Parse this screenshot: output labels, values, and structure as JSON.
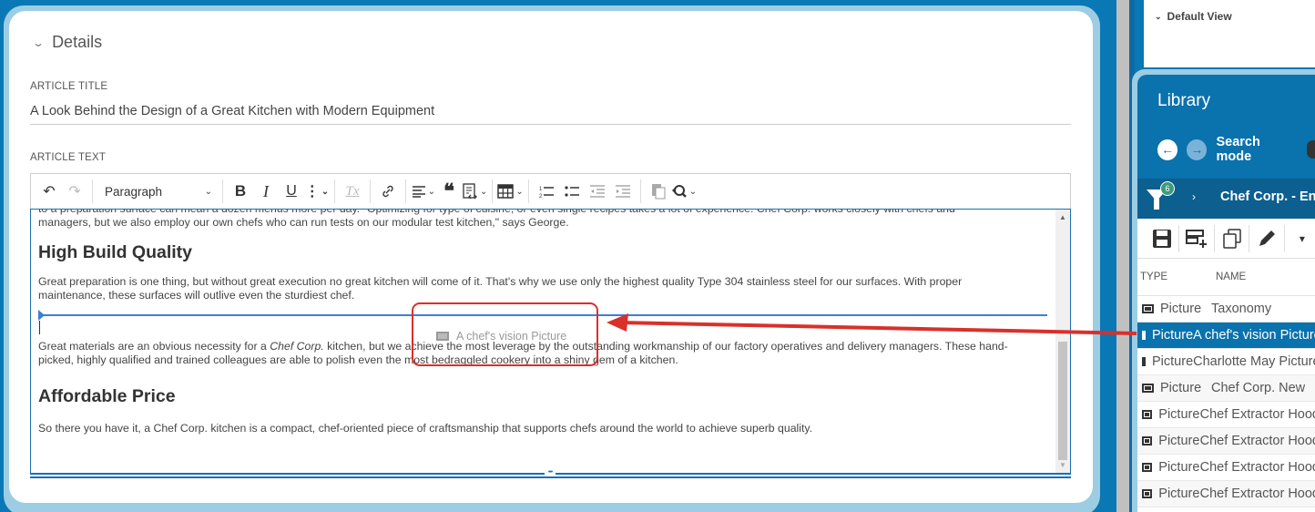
{
  "details": {
    "section_title": "Details",
    "article_title_label": "ARTICLE TITLE",
    "article_title_value": "A Look Behind the Design of a Great Kitchen with Modern Equipment",
    "article_text_label": "ARTICLE TEXT"
  },
  "toolbar": {
    "undo": "undo-icon",
    "redo": "redo-icon",
    "paragraph_format": "Paragraph",
    "bold": "B",
    "italic": "I",
    "underline": "U",
    "more": "⋮",
    "remove_format": "Tx",
    "link": "link-icon",
    "align": "align-left-icon",
    "blockquote": "❝",
    "source": "source-icon",
    "table": "table-icon",
    "numbered_list": "numbered-list-icon",
    "bulleted_list": "bulleted-list-icon",
    "outdent": "outdent-icon",
    "indent": "indent-icon",
    "paste": "paste-icon",
    "find_replace": "find-replace-icon"
  },
  "editor": {
    "para_top_line1": "to a preparation surface can mean a dozen menus more per day. \"Optimizing for type of cuisine, or even single recipes takes a lot of experience. Chef Corp. works closely with chefs and",
    "para_top_line2": "managers, but we also employ our own chefs who can run tests on our modular test kitchen,\" says George.",
    "heading_1": "High Build Quality",
    "para_1": "Great preparation is one thing, but without great execution no great kitchen will come of it. That's why we use only the highest quality Type 304 stainless steel for our surfaces. With proper maintenance, these surfaces will outlive even the sturdiest chef.",
    "drag_ghost_label": "A chef's vision Picture",
    "para_2_before": "Great materials are an obvious necessity for a ",
    "para_2_italic": "Chef Corp.",
    "para_2_after": " kitchen, but we achieve the most leverage by the outstanding workmanship of our factory operatives and delivery managers. These hand-picked, highly qualified and trained colleagues are able to polish even the most bedraggled cookery into a shiny gem of a kitchen.",
    "heading_2": "Affordable Price",
    "para_3": "So there you have it, a Chef Corp. kitchen is a compact, chef-oriented piece of craftsmanship that supports chefs around the world to achieve superb quality."
  },
  "right_panel": {
    "default_view": "Default View"
  },
  "library": {
    "title": "Library",
    "mode": "Search mode",
    "filter_count": "6",
    "path": "Chef Corp. - English",
    "columns": {
      "type": "TYPE",
      "name": "NAME"
    },
    "rows": [
      {
        "type": "Picture",
        "name": "Taxonomy",
        "selected": false
      },
      {
        "type": "Picture",
        "name": "A chef's vision Picture",
        "selected": true
      },
      {
        "type": "Picture",
        "name": "Charlotte May Picture",
        "selected": false
      },
      {
        "type": "Picture",
        "name": "Chef Corp. New",
        "selected": false
      },
      {
        "type": "Picture",
        "name": "Chef Extractor Hood",
        "selected": false
      },
      {
        "type": "Picture",
        "name": "Chef Extractor Hood",
        "selected": false
      },
      {
        "type": "Picture",
        "name": "Chef Extractor Hood",
        "selected": false
      },
      {
        "type": "Picture",
        "name": "Chef Extractor Hood",
        "selected": false
      }
    ]
  },
  "colors": {
    "accent": "#0a72ad",
    "annotation_red": "#d9302b",
    "drop_line": "#3b7fd8",
    "filter_badge": "#3a9c7e"
  }
}
